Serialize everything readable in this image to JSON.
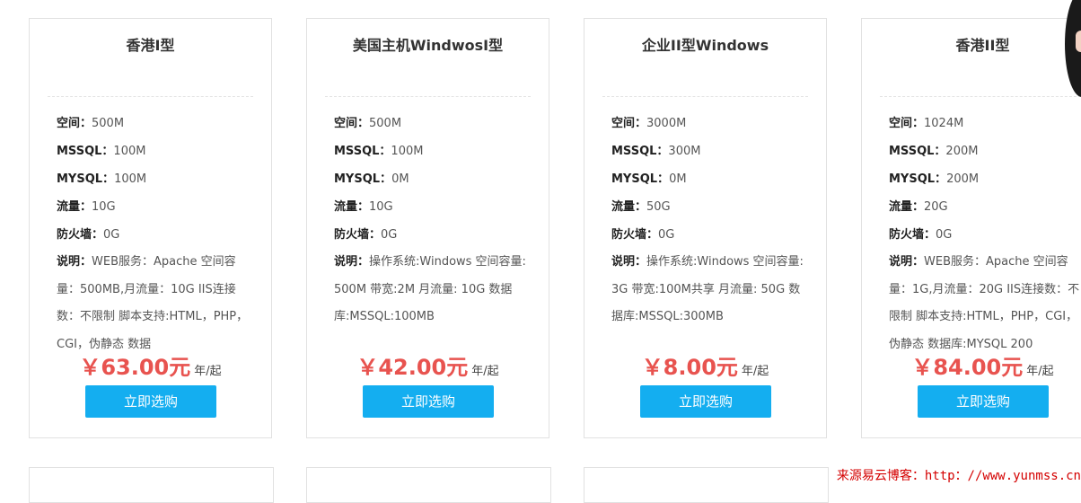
{
  "cards": [
    {
      "title": "香港I型",
      "specs": [
        {
          "key": "空间：",
          "value": "500M"
        },
        {
          "key": "MSSQL：",
          "value": "100M"
        },
        {
          "key": "MYSQL：",
          "value": "100M"
        },
        {
          "key": "流量：",
          "value": "10G"
        },
        {
          "key": "防火墙：",
          "value": "0G"
        }
      ],
      "desc_key": "说明：",
      "desc_text": "WEB服务：Apache 空间容量：500MB,月流量：10G IIS连接数：不限制 脚本支持:HTML，PHP，CGI，伪静态 数据",
      "price": "￥63.00元",
      "price_unit": "年/起",
      "button": "立即选购"
    },
    {
      "title": "美国主机WindwosI型",
      "specs": [
        {
          "key": "空间：",
          "value": "500M"
        },
        {
          "key": "MSSQL：",
          "value": "100M"
        },
        {
          "key": "MYSQL：",
          "value": "0M"
        },
        {
          "key": "流量：",
          "value": "10G"
        },
        {
          "key": "防火墙：",
          "value": "0G"
        }
      ],
      "desc_key": "说明：",
      "desc_text": "操作系统:Windows 空间容量: 500M 带宽:2M 月流量: 10G 数据库:MSSQL:100MB",
      "price": "￥42.00元",
      "price_unit": "年/起",
      "button": "立即选购"
    },
    {
      "title": "企业II型Windows",
      "specs": [
        {
          "key": "空间：",
          "value": "3000M"
        },
        {
          "key": "MSSQL：",
          "value": "300M"
        },
        {
          "key": "MYSQL：",
          "value": "0M"
        },
        {
          "key": "流量：",
          "value": "50G"
        },
        {
          "key": "防火墙：",
          "value": "0G"
        }
      ],
      "desc_key": "说明：",
      "desc_text": "操作系统:Windows 空间容量: 3G 带宽:100M共享 月流量: 50G 数据库:MSSQL:300MB",
      "price": "￥8.00元",
      "price_unit": "年/起",
      "button": "立即选购"
    },
    {
      "title": "香港II型",
      "specs": [
        {
          "key": "空间：",
          "value": "1024M"
        },
        {
          "key": "MSSQL：",
          "value": "200M"
        },
        {
          "key": "MYSQL：",
          "value": "200M"
        },
        {
          "key": "流量：",
          "value": "20G"
        },
        {
          "key": "防火墙：",
          "value": "0G"
        }
      ],
      "desc_key": "说明：",
      "desc_text": "WEB服务：Apache 空间容量：1G,月流量：20G IIS连接数：不限制 脚本支持:HTML，PHP，CGI，伪静态 数据库:MYSQL 200",
      "price": "￥84.00元",
      "price_unit": "年/起",
      "button": "立即选购"
    }
  ],
  "watermark": "来源易云博客：http：//www.yunmss.cn",
  "colors": {
    "price": "#e8534f",
    "button_bg": "#14aef0",
    "border": "#e1e1e1",
    "watermark": "#d40000"
  }
}
